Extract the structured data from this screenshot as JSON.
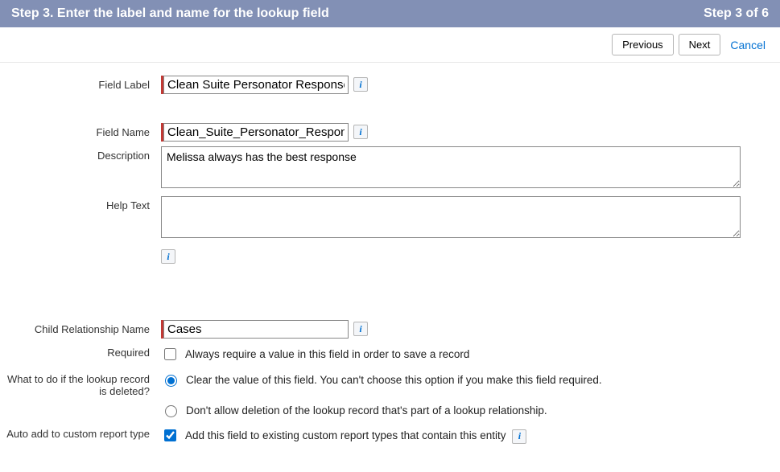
{
  "header": {
    "title": "Step 3. Enter the label and name for the lookup field",
    "step": "Step 3 of 6"
  },
  "buttons": {
    "previous": "Previous",
    "next": "Next",
    "cancel": "Cancel"
  },
  "labels": {
    "fieldLabel": "Field Label",
    "fieldName": "Field Name",
    "description": "Description",
    "helpText": "Help Text",
    "childRel": "Child Relationship Name",
    "required": "Required",
    "onDelete": "What to do if the lookup record is deleted?",
    "autoAdd": "Auto add to custom report type"
  },
  "values": {
    "fieldLabel": "Clean Suite Personator Response",
    "fieldName": "Clean_Suite_Personator_Response",
    "description": "Melissa always has the best response",
    "helpText": "",
    "childRel": "Cases"
  },
  "options": {
    "required": "Always require a value in this field in order to save a record",
    "clearValue": "Clear the value of this field. You can't choose this option if you make this field required.",
    "dontAllow": "Don't allow deletion of the lookup record that's part of a lookup relationship.",
    "autoAdd": "Add this field to existing custom report types that contain this entity"
  },
  "info": "i"
}
